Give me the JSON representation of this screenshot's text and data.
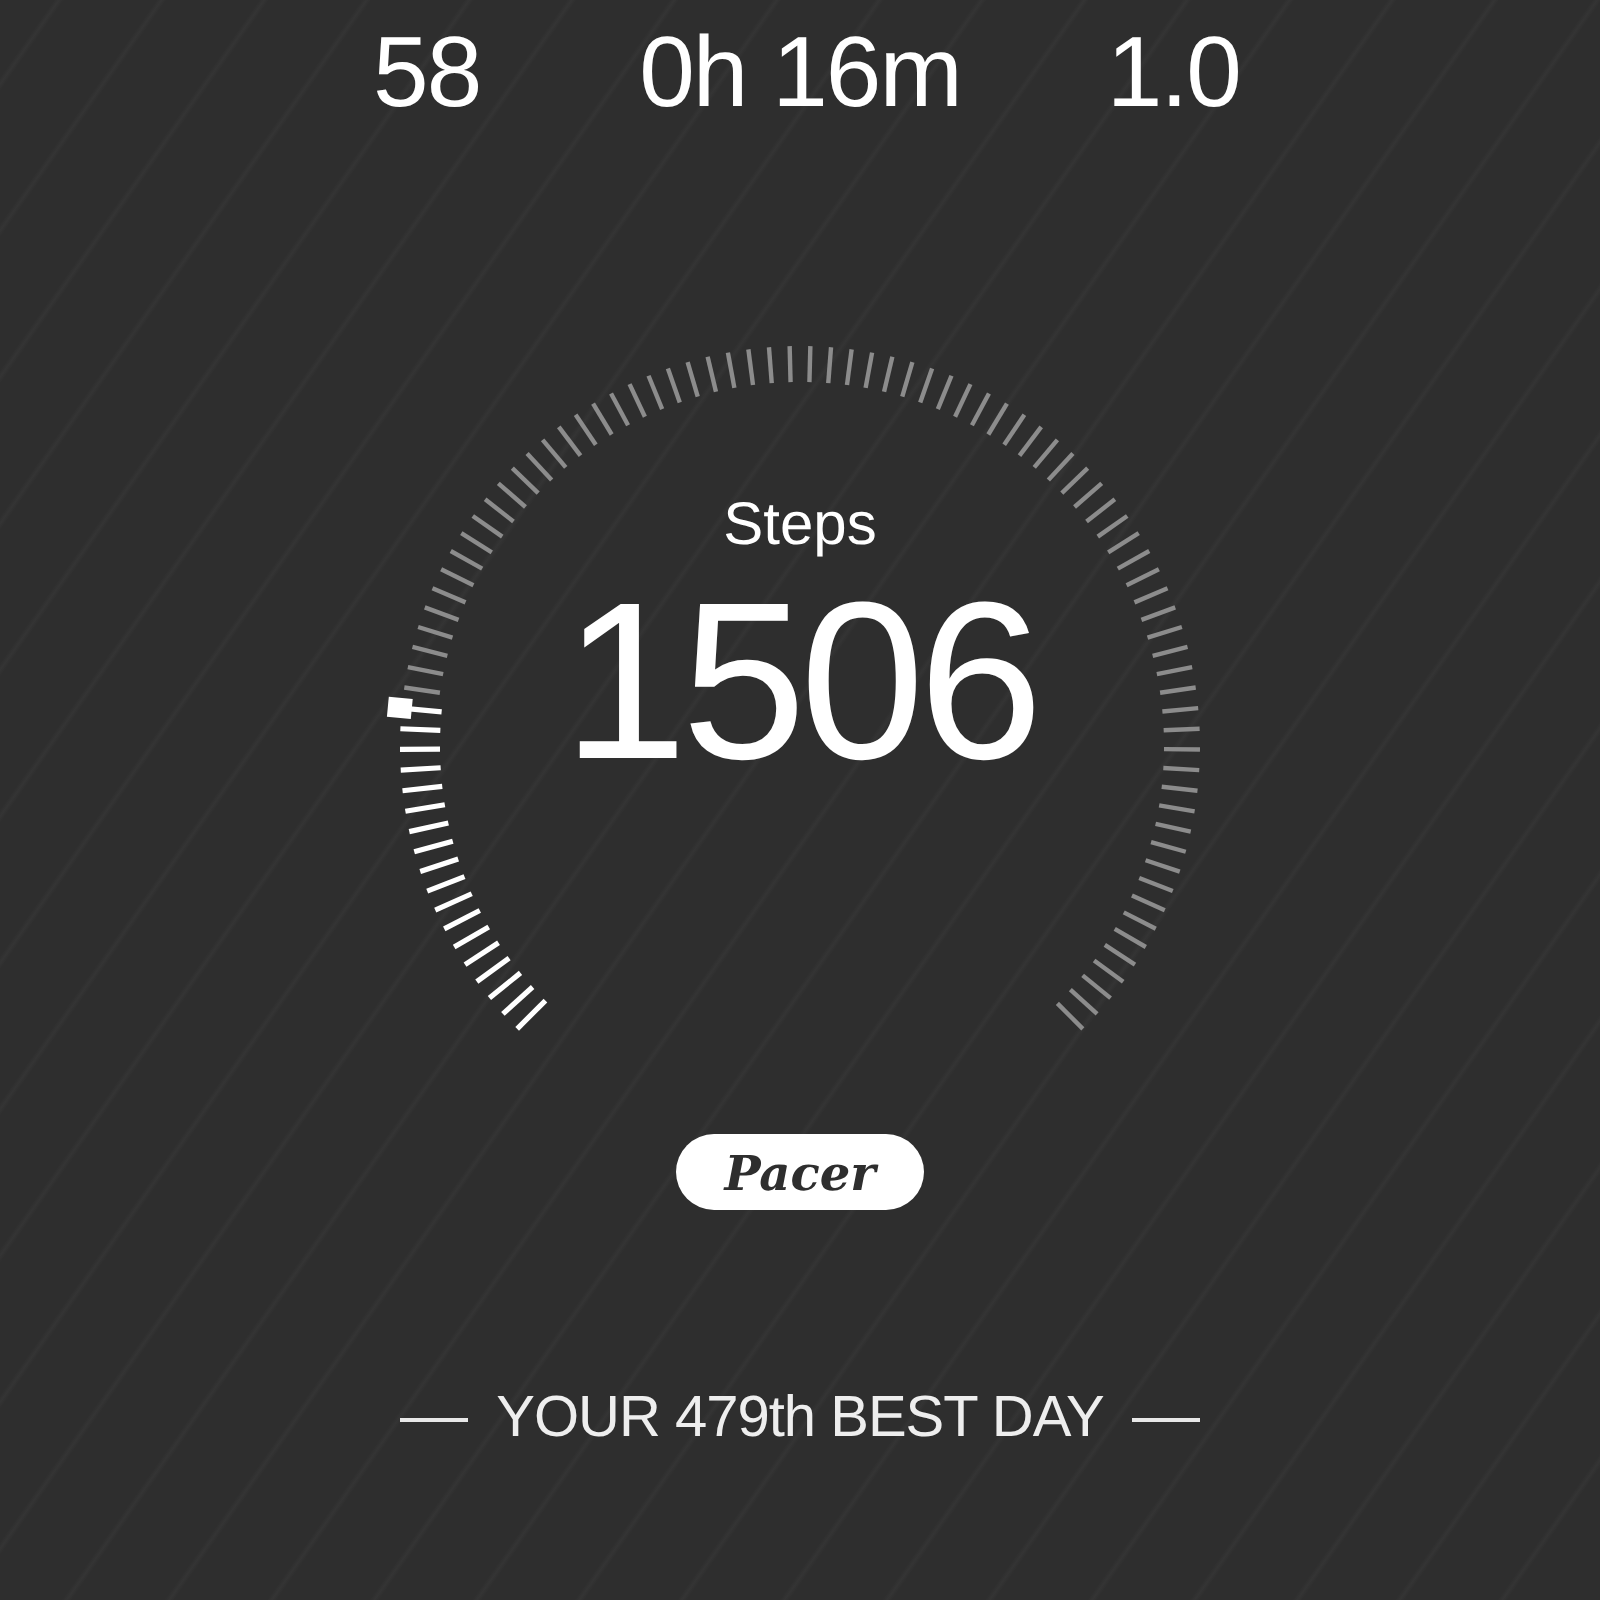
{
  "stats": [
    {
      "value": "58"
    },
    {
      "value": "0h 16m"
    },
    {
      "value": "1.0"
    }
  ],
  "gauge": {
    "label": "Steps",
    "value": "1506"
  },
  "logo": "Pacer",
  "rank": "YOUR 479th BEST DAY"
}
